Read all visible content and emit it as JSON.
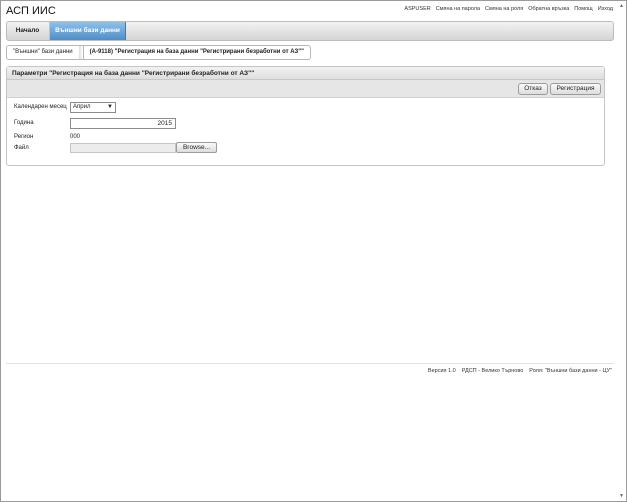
{
  "app": {
    "title": "АСП ИИС"
  },
  "top_links": [
    "ASPUSER",
    "Смяна на парола",
    "Смяна на роля",
    "Обратна връзка",
    "Помощ",
    "Изход"
  ],
  "nav": {
    "home": "Начало",
    "active": "Външни бази данни"
  },
  "breadcrumb": {
    "first": "\"Външни\" бази данни",
    "current": "(A-9118) \"Регистрация на база данни \"Регистрирани безработни от АЗ\"\""
  },
  "panel": {
    "title": "Параметри \"Регистрация на база данни \"Регистрирани безработни от АЗ\"\"",
    "buttons": {
      "cancel": "Отказ",
      "register": "Регистрация"
    }
  },
  "form": {
    "month_label": "Календарен месец",
    "month_value": "Април",
    "year_label": "Година",
    "year_value": "2015",
    "region_label": "Регион",
    "region_value": "000",
    "file_label": "Файл",
    "browse_label": "Browse..."
  },
  "footer": {
    "version": "Версия 1.0",
    "office": "РДСП - Велико Търново",
    "role": "Роля: \"Външни бази данни - ЦУ\""
  },
  "icons": {
    "dropdown": "chevron-down-icon",
    "scroll_up": "scroll-up-icon",
    "scroll_down": "scroll-down-icon"
  }
}
